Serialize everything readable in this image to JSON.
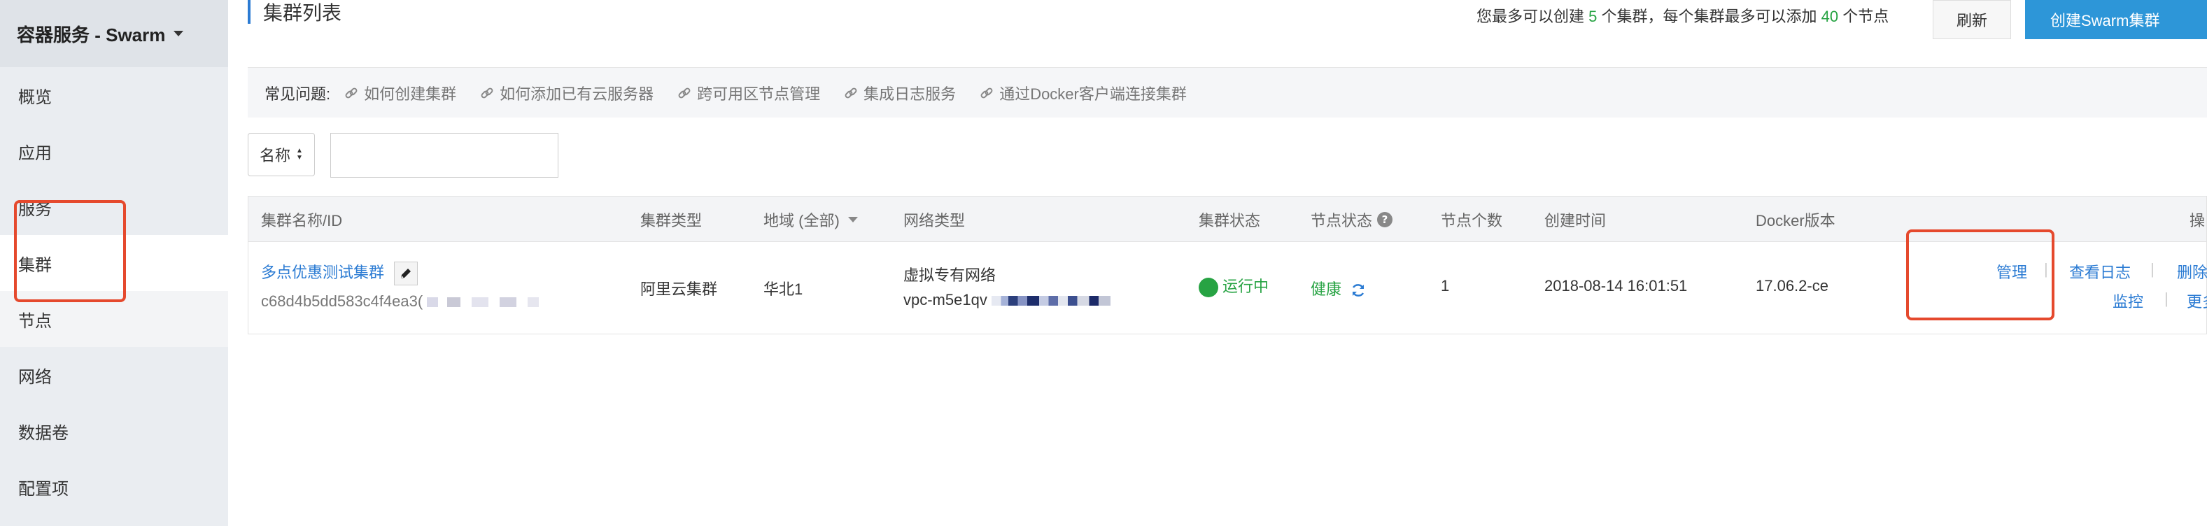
{
  "sidebar": {
    "title": "容器服务 - Swarm",
    "items": [
      {
        "label": "概览"
      },
      {
        "label": "应用"
      },
      {
        "label": "服务"
      },
      {
        "label": "集群"
      },
      {
        "label": "节点"
      },
      {
        "label": "网络"
      },
      {
        "label": "数据卷"
      },
      {
        "label": "配置项"
      }
    ]
  },
  "header": {
    "title": "集群列表",
    "quota_prefix": "您最多可以创建",
    "quota_clusters": "5",
    "quota_middle": "个集群，每个集群最多可以添加",
    "quota_nodes": "40",
    "quota_suffix": "个节点",
    "refresh_label": "刷新",
    "create_label": "创建Swarm集群"
  },
  "faq": {
    "label": "常见问题:",
    "links": [
      {
        "label": "如何创建集群"
      },
      {
        "label": "如何添加已有云服务器"
      },
      {
        "label": "跨可用区节点管理"
      },
      {
        "label": "集成日志服务"
      },
      {
        "label": "通过Docker客户端连接集群"
      }
    ]
  },
  "filter": {
    "select_value": "名称",
    "input_value": ""
  },
  "table": {
    "headers": {
      "name": "集群名称/ID",
      "type": "集群类型",
      "region": "地域 (全部)",
      "network": "网络类型",
      "status": "集群状态",
      "node_status": "节点状态",
      "node_count": "节点个数",
      "created": "创建时间",
      "docker": "Docker版本",
      "actions": "操"
    },
    "rows": [
      {
        "name": "多点优惠测试集群",
        "id": "c68d4b5dd583c4f4ea3(",
        "type": "阿里云集群",
        "region": "华北1",
        "network_type": "虚拟专有网络",
        "vpc": "vpc-m5e1qv",
        "status": "运行中",
        "node_status": "健康",
        "node_count": "1",
        "created": "2018-08-14 16:01:51",
        "docker": "17.06.2-ce",
        "actions": {
          "manage": "管理",
          "logs": "查看日志",
          "delete": "删除",
          "monitor": "监控",
          "more": "更多"
        }
      }
    ]
  },
  "colors": {
    "accent": "#2b7bd3",
    "primary_button": "#2d96d8",
    "success": "#27a343",
    "highlight": "#e5492d"
  }
}
